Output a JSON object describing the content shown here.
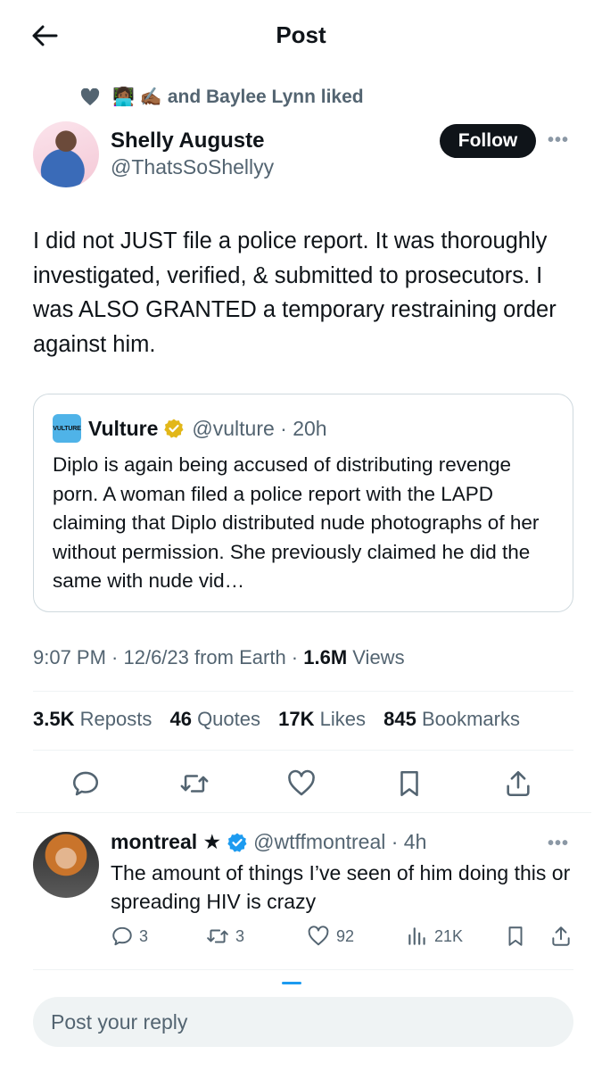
{
  "header": {
    "title": "Post",
    "back_icon": "arrow-left-icon"
  },
  "social_context": {
    "text": "and Baylee Lynn liked",
    "emojis": [
      "👩🏾‍💻",
      "✍🏾"
    ],
    "icon": "heart-icon"
  },
  "author": {
    "name": "Shelly Auguste",
    "handle": "@ThatsSoShellyy",
    "follow_label": "Follow"
  },
  "more_label": "•••",
  "tweet": {
    "text": "I did not JUST file a police report. It was thoroughly investigated, verified, & submitted to prosecutors. I was ALSO GRANTED a temporary restraining order against him."
  },
  "quote": {
    "logo_text": "VULTURE",
    "name": "Vulture",
    "handle": "@vulture · 20h",
    "text": "Diplo is again being accused of distributing revenge porn. A woman filed a police report with the LAPD claiming that Diplo distributed nude photographs of her without permission. She previously claimed he did the same with nude vid…",
    "badge_color": "#e2b719"
  },
  "meta": {
    "time": "9:07 PM · 12/6/23 from Earth · ",
    "views_count": "1.6M",
    "views_label": " Views"
  },
  "stats": {
    "reposts_count": "3.5K",
    "reposts_label": "Reposts",
    "quotes_count": "46",
    "quotes_label": "Quotes",
    "likes_count": "17K",
    "likes_label": "Likes",
    "bookmarks_count": "845",
    "bookmarks_label": "Bookmarks"
  },
  "reply": {
    "name": "montreal ★",
    "handle": "@wtffmontreal · 4h",
    "text": "The amount of things I’ve seen of him doing this or spreading HIV is crazy",
    "replies": "3",
    "reposts": "3",
    "likes": "92",
    "views": "21K"
  },
  "composer": {
    "placeholder": "Post your reply"
  },
  "colors": {
    "verified_blue": "#1d9bf0",
    "text_secondary": "#536471",
    "follow_bg": "#0f1419"
  }
}
